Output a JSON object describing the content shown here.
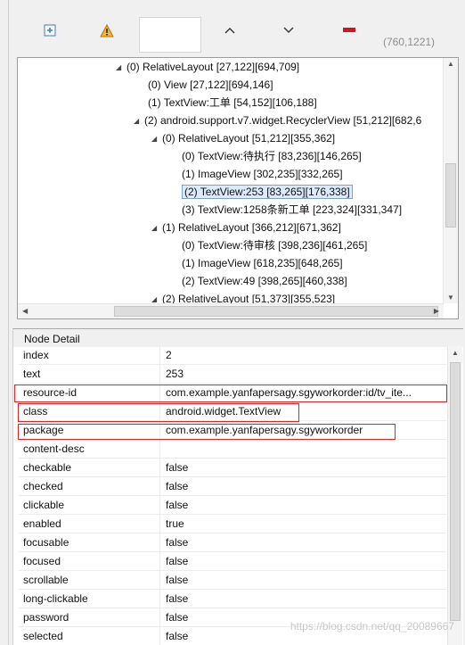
{
  "toolbar": {
    "buttons": [
      {
        "name": "expand-all-icon"
      },
      {
        "name": "warning-icon"
      },
      {
        "name": "chevron-up-icon"
      },
      {
        "name": "chevron-down-icon"
      },
      {
        "name": "minus-icon"
      }
    ],
    "coords": "(760,1221)"
  },
  "tree": [
    {
      "label": "(0) RelativeLayout [27,122][694,709]",
      "expanded": true
    },
    {
      "label": "(0) View [27,122][694,146]",
      "expanded": false
    },
    {
      "label": "(1) TextView:工单 [54,152][106,188]",
      "expanded": false
    },
    {
      "label": "(2) android.support.v7.widget.RecyclerView [51,212][682,6",
      "expanded": true
    },
    {
      "label": "(0) RelativeLayout [51,212][355,362]",
      "expanded": true
    },
    {
      "label": "(0) TextView:待执行 [83,236][146,265]",
      "expanded": false
    },
    {
      "label": "(1) ImageView [302,235][332,265]",
      "expanded": false
    },
    {
      "label": "(2) TextView:253 [83,265][176,338]",
      "expanded": false
    },
    {
      "label": "(3) TextView:1258条新工单 [223,324][331,347]",
      "expanded": false
    },
    {
      "label": "(1) RelativeLayout [366,212][671,362]",
      "expanded": true
    },
    {
      "label": "(0) TextView:待审核 [398,236][461,265]",
      "expanded": false
    },
    {
      "label": "(1) ImageView [618,235][648,265]",
      "expanded": false
    },
    {
      "label": "(2) TextView:49 [398,265][460,338]",
      "expanded": false
    },
    {
      "label": "(2) RelativeLayout [51,373][355,523]",
      "expanded": true
    }
  ],
  "detail": {
    "title": "Node Detail",
    "rows": [
      {
        "key": "index",
        "value": "2"
      },
      {
        "key": "text",
        "value": "253"
      },
      {
        "key": "resource-id",
        "value": "com.example.yanfapersagy.sgyworkorder:id/tv_ite..."
      },
      {
        "key": "class",
        "value": "android.widget.TextView"
      },
      {
        "key": "package",
        "value": "com.example.yanfapersagy.sgyworkorder"
      },
      {
        "key": "content-desc",
        "value": ""
      },
      {
        "key": "checkable",
        "value": "false"
      },
      {
        "key": "checked",
        "value": "false"
      },
      {
        "key": "clickable",
        "value": "false"
      },
      {
        "key": "enabled",
        "value": "true"
      },
      {
        "key": "focusable",
        "value": "false"
      },
      {
        "key": "focused",
        "value": "false"
      },
      {
        "key": "scrollable",
        "value": "false"
      },
      {
        "key": "long-clickable",
        "value": "false"
      },
      {
        "key": "password",
        "value": "false"
      },
      {
        "key": "selected",
        "value": "false"
      }
    ]
  },
  "watermark": "https://blog.csdn.net/qq_20089667",
  "colors": {
    "highlight": "#d9262b",
    "selection": "#dcebfb"
  }
}
